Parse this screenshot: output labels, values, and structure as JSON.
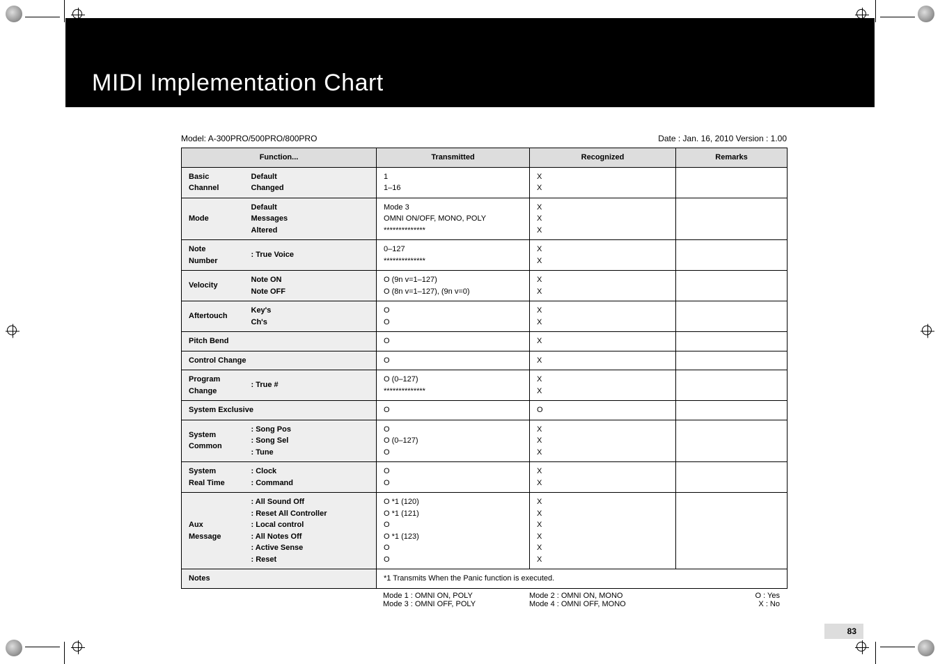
{
  "title": "MIDI Implementation Chart",
  "model_label": "Model: A-300PRO/500PRO/800PRO",
  "date_version": "Date : Jan. 16, 2010  Version : 1.00",
  "headers": {
    "function": "Function...",
    "transmitted": "Transmitted",
    "recognized": "Recognized",
    "remarks": "Remarks"
  },
  "rows": [
    {
      "fn1": "Basic\nChannel",
      "fn2": "Default\nChanged",
      "tx": "1\n1–16",
      "rx": "X\nX",
      "rm": ""
    },
    {
      "fn1": "Mode",
      "fn2": "Default\nMessages\nAltered",
      "tx": "Mode 3\nOMNI ON/OFF, MONO, POLY\n**************",
      "rx": "X\nX\nX",
      "rm": ""
    },
    {
      "fn1": "Note\nNumber",
      "fn2": ": True Voice",
      "tx": "0–127\n**************",
      "rx": "X\nX",
      "rm": ""
    },
    {
      "fn1": "Velocity",
      "fn2": "Note ON\nNote OFF",
      "tx": "O (9n v=1–127)\nO (8n v=1–127), (9n v=0)",
      "rx": "X\nX",
      "rm": ""
    },
    {
      "fn1": "Aftertouch",
      "fn2": "Key's\nCh's",
      "tx": "O\nO",
      "rx": "X\nX",
      "rm": ""
    },
    {
      "fn1": "Pitch Bend",
      "fn2": "",
      "tx": "O",
      "rx": "X",
      "rm": ""
    },
    {
      "fn1": "Control Change",
      "fn2": "",
      "tx": "O",
      "rx": "X",
      "rm": ""
    },
    {
      "fn1": "Program\nChange",
      "fn2": ": True #",
      "tx": "O (0–127)\n**************",
      "rx": "X\nX",
      "rm": ""
    },
    {
      "fn1": "System Exclusive",
      "fn2": "",
      "tx": "O",
      "rx": "O",
      "rm": ""
    },
    {
      "fn1": "System\nCommon",
      "fn2": ": Song Pos\n: Song Sel\n: Tune",
      "tx": "O\nO (0–127)\nO",
      "rx": "X\nX\nX",
      "rm": ""
    },
    {
      "fn1": "System\nReal Time",
      "fn2": ": Clock\n: Command",
      "tx": "O\nO",
      "rx": "X\nX",
      "rm": ""
    },
    {
      "fn1": "Aux Message",
      "fn2": ": All Sound Off\n: Reset All Controller\n: Local control\n: All Notes Off\n: Active Sense\n: Reset",
      "tx": "O *1 (120)\nO *1 (121)\nO\nO *1 (123)\nO\nO",
      "rx": "X\nX\nX\nX\nX\nX",
      "rm": ""
    },
    {
      "fn1": "Notes",
      "fn2": "",
      "tx_span": "*1 Transmits When the Panic function is executed."
    }
  ],
  "footer": {
    "mode1": "Mode 1 : OMNI ON, POLY",
    "mode2": "Mode 2 : OMNI ON, MONO",
    "mode3": "Mode 3 : OMNI OFF, POLY",
    "mode4": "Mode 4 : OMNI OFF, MONO",
    "oyes": "O : Yes",
    "xno": "X : No"
  },
  "page_number": "83"
}
